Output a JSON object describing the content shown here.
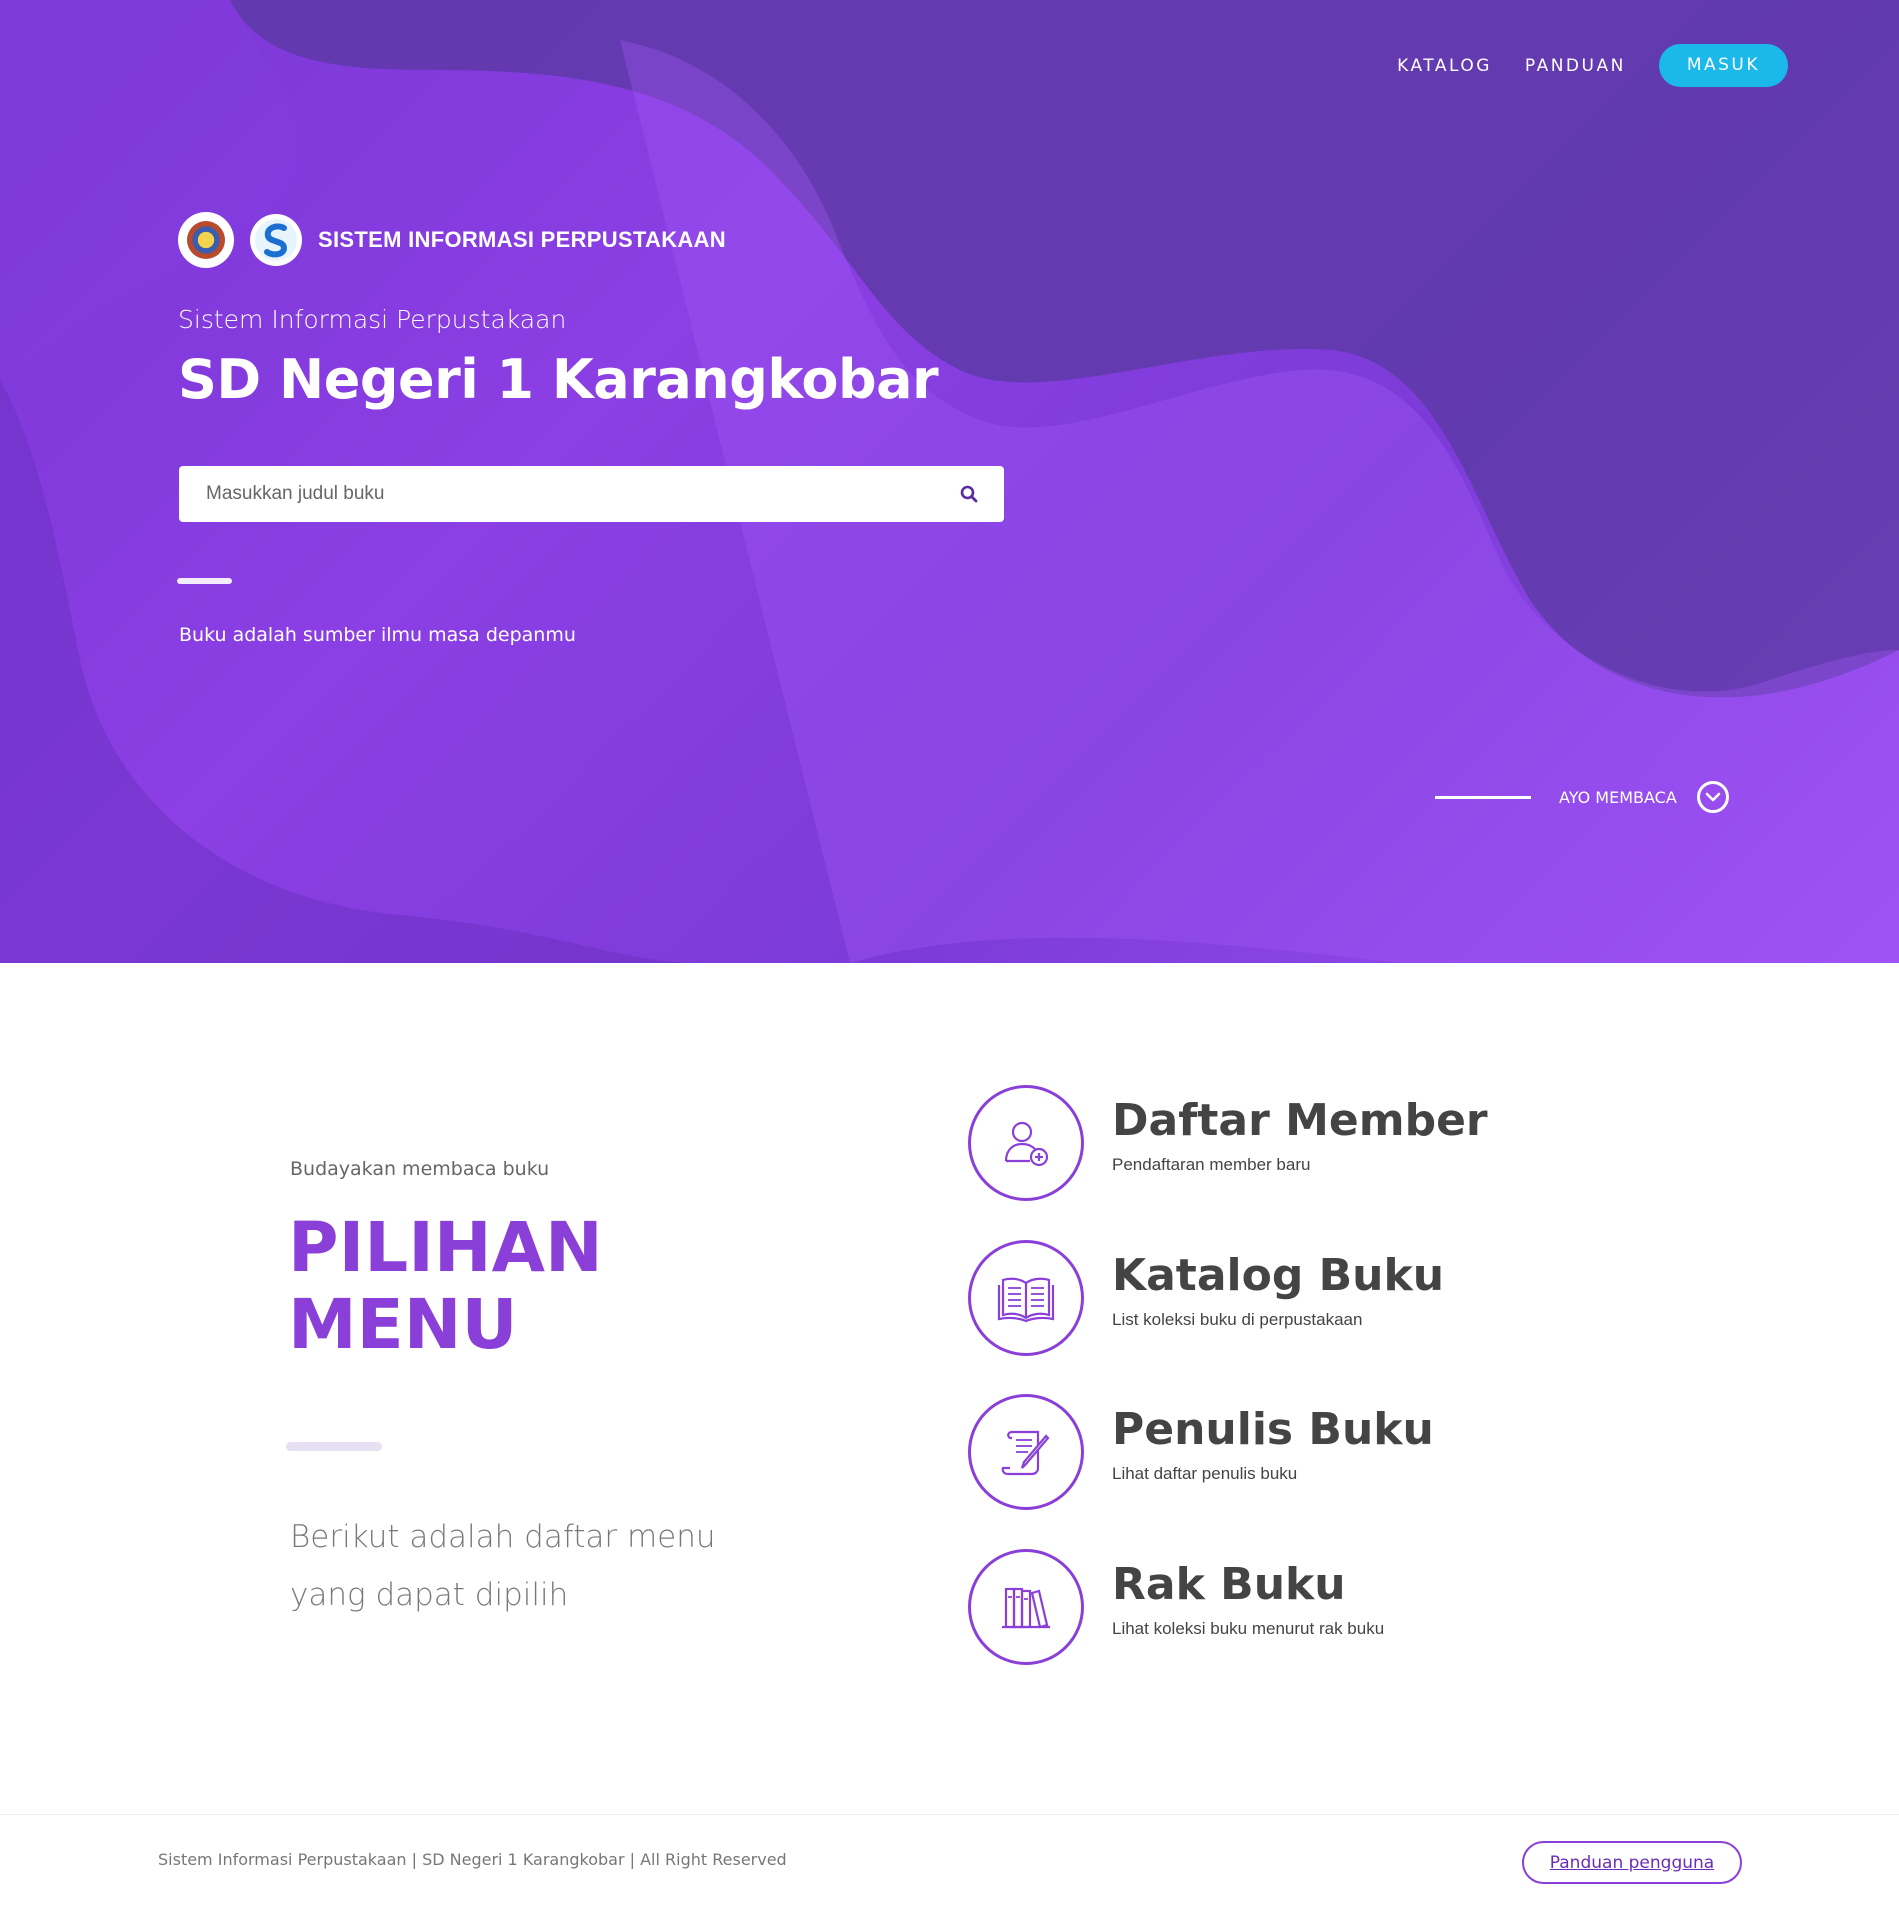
{
  "nav": {
    "katalog": "KATALOG",
    "panduan": "PANDUAN",
    "masuk": "MASUK"
  },
  "brand": {
    "text": "SISTEM INFORMASI PERPUSTAKAAN"
  },
  "hero": {
    "subtitle": "Sistem Informasi Perpustakaan",
    "title": "SD Negeri 1 Karangkobar",
    "search_placeholder": "Masukkan judul buku",
    "quote": "Buku adalah sumber ilmu masa depanmu",
    "scroll_label": "AYO MEMBACA"
  },
  "section": {
    "subtitle": "Budayakan membaca buku",
    "title_line1": "PILIHAN",
    "title_line2": "MENU",
    "description": "Berikut adalah daftar menu yang dapat dipilih"
  },
  "menu": [
    {
      "title": "Daftar Member",
      "desc": "Pendaftaran member baru",
      "icon": "add-user-icon"
    },
    {
      "title": "Katalog Buku",
      "desc": "List koleksi buku di perpustakaan",
      "icon": "open-book-icon"
    },
    {
      "title": "Penulis Buku",
      "desc": "Lihat daftar penulis buku",
      "icon": "writing-icon"
    },
    {
      "title": "Rak Buku",
      "desc": "Lihat koleksi buku menurut rak buku",
      "icon": "bookshelf-icon"
    }
  ],
  "footer": {
    "text": "Sistem Informasi Perpustakaan | SD Negeri 1 Karangkobar | All Right Reserved",
    "button": "Panduan pengguna"
  },
  "colors": {
    "accent": "#8a40d8",
    "hero_gradient_start": "#7a36d6",
    "hero_gradient_end": "#9d50f5",
    "login_button": "#1bb9ea"
  }
}
